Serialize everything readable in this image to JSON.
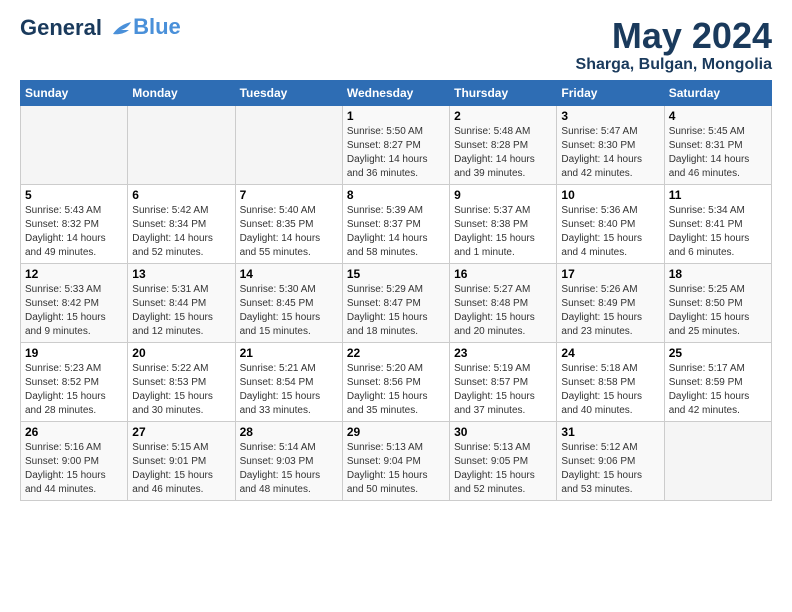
{
  "logo": {
    "line1": "General",
    "line2": "Blue"
  },
  "title": "May 2024",
  "subtitle": "Sharga, Bulgan, Mongolia",
  "weekdays": [
    "Sunday",
    "Monday",
    "Tuesday",
    "Wednesday",
    "Thursday",
    "Friday",
    "Saturday"
  ],
  "weeks": [
    [
      {
        "day": "",
        "info": ""
      },
      {
        "day": "",
        "info": ""
      },
      {
        "day": "",
        "info": ""
      },
      {
        "day": "1",
        "info": "Sunrise: 5:50 AM\nSunset: 8:27 PM\nDaylight: 14 hours\nand 36 minutes."
      },
      {
        "day": "2",
        "info": "Sunrise: 5:48 AM\nSunset: 8:28 PM\nDaylight: 14 hours\nand 39 minutes."
      },
      {
        "day": "3",
        "info": "Sunrise: 5:47 AM\nSunset: 8:30 PM\nDaylight: 14 hours\nand 42 minutes."
      },
      {
        "day": "4",
        "info": "Sunrise: 5:45 AM\nSunset: 8:31 PM\nDaylight: 14 hours\nand 46 minutes."
      }
    ],
    [
      {
        "day": "5",
        "info": "Sunrise: 5:43 AM\nSunset: 8:32 PM\nDaylight: 14 hours\nand 49 minutes."
      },
      {
        "day": "6",
        "info": "Sunrise: 5:42 AM\nSunset: 8:34 PM\nDaylight: 14 hours\nand 52 minutes."
      },
      {
        "day": "7",
        "info": "Sunrise: 5:40 AM\nSunset: 8:35 PM\nDaylight: 14 hours\nand 55 minutes."
      },
      {
        "day": "8",
        "info": "Sunrise: 5:39 AM\nSunset: 8:37 PM\nDaylight: 14 hours\nand 58 minutes."
      },
      {
        "day": "9",
        "info": "Sunrise: 5:37 AM\nSunset: 8:38 PM\nDaylight: 15 hours\nand 1 minute."
      },
      {
        "day": "10",
        "info": "Sunrise: 5:36 AM\nSunset: 8:40 PM\nDaylight: 15 hours\nand 4 minutes."
      },
      {
        "day": "11",
        "info": "Sunrise: 5:34 AM\nSunset: 8:41 PM\nDaylight: 15 hours\nand 6 minutes."
      }
    ],
    [
      {
        "day": "12",
        "info": "Sunrise: 5:33 AM\nSunset: 8:42 PM\nDaylight: 15 hours\nand 9 minutes."
      },
      {
        "day": "13",
        "info": "Sunrise: 5:31 AM\nSunset: 8:44 PM\nDaylight: 15 hours\nand 12 minutes."
      },
      {
        "day": "14",
        "info": "Sunrise: 5:30 AM\nSunset: 8:45 PM\nDaylight: 15 hours\nand 15 minutes."
      },
      {
        "day": "15",
        "info": "Sunrise: 5:29 AM\nSunset: 8:47 PM\nDaylight: 15 hours\nand 18 minutes."
      },
      {
        "day": "16",
        "info": "Sunrise: 5:27 AM\nSunset: 8:48 PM\nDaylight: 15 hours\nand 20 minutes."
      },
      {
        "day": "17",
        "info": "Sunrise: 5:26 AM\nSunset: 8:49 PM\nDaylight: 15 hours\nand 23 minutes."
      },
      {
        "day": "18",
        "info": "Sunrise: 5:25 AM\nSunset: 8:50 PM\nDaylight: 15 hours\nand 25 minutes."
      }
    ],
    [
      {
        "day": "19",
        "info": "Sunrise: 5:23 AM\nSunset: 8:52 PM\nDaylight: 15 hours\nand 28 minutes."
      },
      {
        "day": "20",
        "info": "Sunrise: 5:22 AM\nSunset: 8:53 PM\nDaylight: 15 hours\nand 30 minutes."
      },
      {
        "day": "21",
        "info": "Sunrise: 5:21 AM\nSunset: 8:54 PM\nDaylight: 15 hours\nand 33 minutes."
      },
      {
        "day": "22",
        "info": "Sunrise: 5:20 AM\nSunset: 8:56 PM\nDaylight: 15 hours\nand 35 minutes."
      },
      {
        "day": "23",
        "info": "Sunrise: 5:19 AM\nSunset: 8:57 PM\nDaylight: 15 hours\nand 37 minutes."
      },
      {
        "day": "24",
        "info": "Sunrise: 5:18 AM\nSunset: 8:58 PM\nDaylight: 15 hours\nand 40 minutes."
      },
      {
        "day": "25",
        "info": "Sunrise: 5:17 AM\nSunset: 8:59 PM\nDaylight: 15 hours\nand 42 minutes."
      }
    ],
    [
      {
        "day": "26",
        "info": "Sunrise: 5:16 AM\nSunset: 9:00 PM\nDaylight: 15 hours\nand 44 minutes."
      },
      {
        "day": "27",
        "info": "Sunrise: 5:15 AM\nSunset: 9:01 PM\nDaylight: 15 hours\nand 46 minutes."
      },
      {
        "day": "28",
        "info": "Sunrise: 5:14 AM\nSunset: 9:03 PM\nDaylight: 15 hours\nand 48 minutes."
      },
      {
        "day": "29",
        "info": "Sunrise: 5:13 AM\nSunset: 9:04 PM\nDaylight: 15 hours\nand 50 minutes."
      },
      {
        "day": "30",
        "info": "Sunrise: 5:13 AM\nSunset: 9:05 PM\nDaylight: 15 hours\nand 52 minutes."
      },
      {
        "day": "31",
        "info": "Sunrise: 5:12 AM\nSunset: 9:06 PM\nDaylight: 15 hours\nand 53 minutes."
      },
      {
        "day": "",
        "info": ""
      }
    ]
  ]
}
